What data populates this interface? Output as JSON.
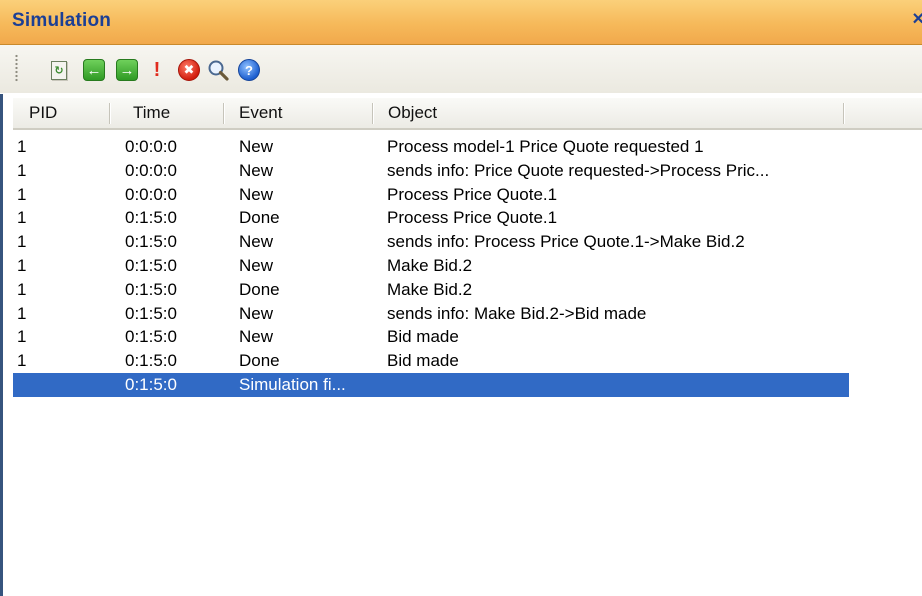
{
  "window": {
    "title": "Simulation",
    "close_label": "×"
  },
  "toolbar": {
    "buttons": [
      {
        "name": "refresh-icon",
        "glyph": "↻"
      },
      {
        "name": "back-icon",
        "glyph": "←"
      },
      {
        "name": "forward-icon",
        "glyph": "→"
      },
      {
        "name": "exclamation-icon",
        "glyph": "!"
      },
      {
        "name": "stop-icon",
        "glyph": "✖"
      },
      {
        "name": "search-icon",
        "glyph": ""
      },
      {
        "name": "help-icon",
        "glyph": "?"
      }
    ]
  },
  "table": {
    "columns": [
      "PID",
      "Time",
      "Event",
      "Object"
    ],
    "rows": [
      [
        "1",
        "0:0:0:0",
        "New",
        "Process model-1 Price Quote requested 1"
      ],
      [
        "1",
        "0:0:0:0",
        "New",
        "sends info: Price Quote requested->Process Pric..."
      ],
      [
        "1",
        "0:0:0:0",
        "New",
        "Process Price Quote.1"
      ],
      [
        "1",
        "0:1:5:0",
        "Done",
        "Process Price Quote.1"
      ],
      [
        "1",
        "0:1:5:0",
        "New",
        "sends info: Process Price Quote.1->Make Bid.2"
      ],
      [
        "1",
        "0:1:5:0",
        "New",
        "Make Bid.2"
      ],
      [
        "1",
        "0:1:5:0",
        "Done",
        "Make Bid.2"
      ],
      [
        "1",
        "0:1:5:0",
        "New",
        "sends info: Make Bid.2->Bid made"
      ],
      [
        "1",
        "0:1:5:0",
        "New",
        "Bid made"
      ],
      [
        "1",
        "0:1:5:0",
        "Done",
        "Bid made"
      ],
      [
        "",
        "0:1:5:0",
        "Simulation fi...",
        ""
      ]
    ],
    "selected_row": 10
  },
  "colors": {
    "title_bar": "#f6b95a",
    "title_text": "#1c3f95",
    "selection": "#316ac5"
  }
}
